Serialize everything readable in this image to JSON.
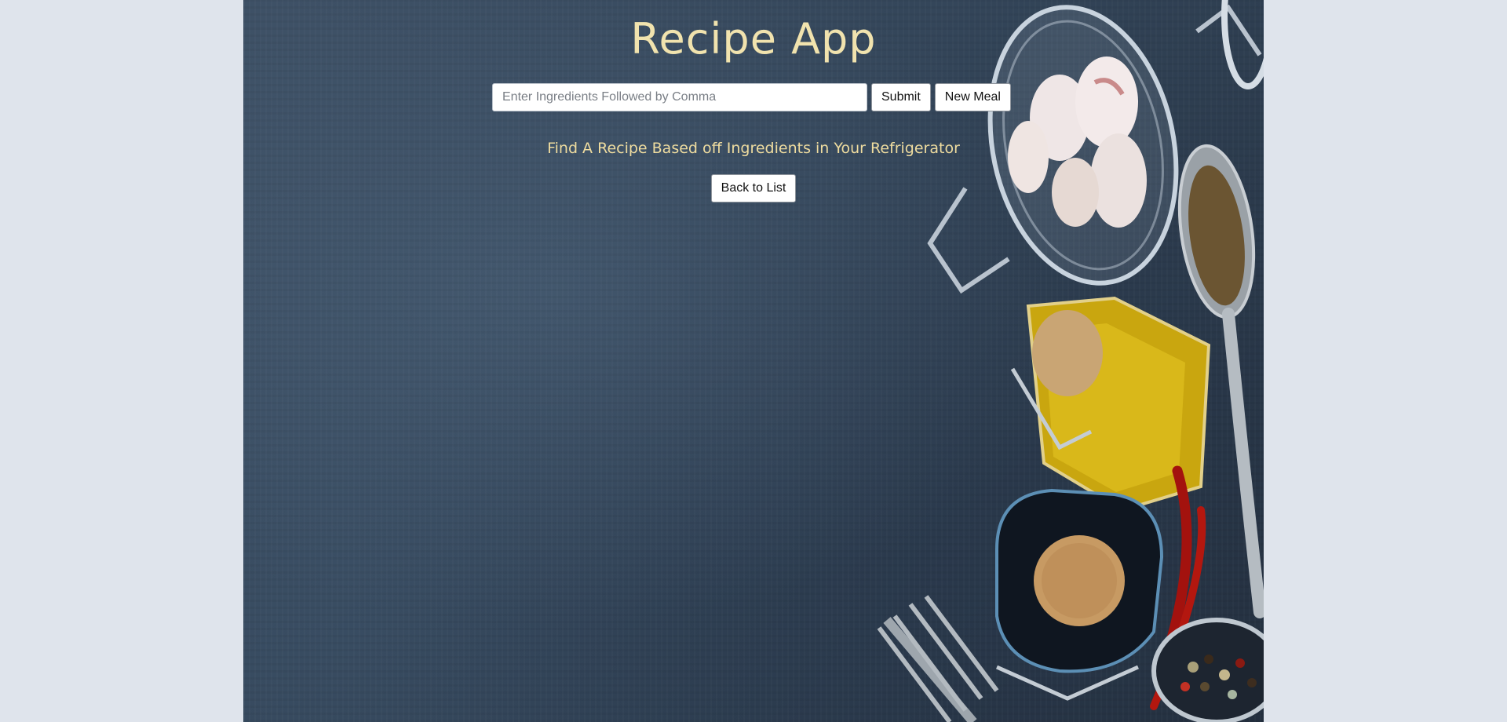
{
  "app": {
    "title": "Recipe App",
    "subtitle": "Find A Recipe Based off Ingredients in Your Refrigerator"
  },
  "search": {
    "value": "",
    "placeholder": "Enter Ingredients Followed by Comma"
  },
  "buttons": {
    "submit": "Submit",
    "new_meal": "New Meal",
    "back": "Back to List"
  },
  "colors": {
    "title": "#f1e3ae",
    "subtitle": "#efdc9f",
    "backdrop": "#34465a",
    "page": "#dfe4ec"
  }
}
